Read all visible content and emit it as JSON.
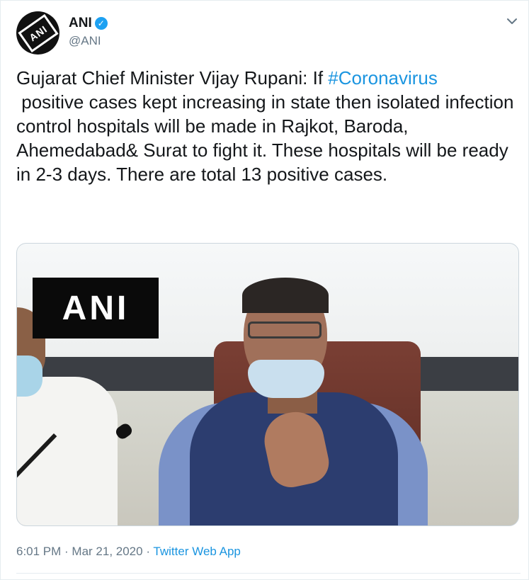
{
  "account": {
    "display_name": "ANI",
    "handle": "@ANI",
    "verified_icon": "verified-badge-icon",
    "avatar_logo_text": "ANI"
  },
  "tweet": {
    "text_before": "Gujarat Chief Minister Vijay Rupani: If ",
    "hashtag": "#Coronavirus",
    "text_after": "\n positive cases kept increasing in state then isolated infection control hospitals will be made in Rajkot, Baroda, Ahemedabad& Surat to fight it. These hospitals will be ready in 2-3 days. There are total 13 positive cases."
  },
  "media": {
    "overlay_logo_text": "ANI"
  },
  "meta": {
    "time": "6:01 PM",
    "separator": " · ",
    "date": "Mar 21, 2020",
    "source": "Twitter Web App"
  },
  "colors": {
    "link": "#1b95e0",
    "verified": "#1da1f2",
    "secondary_text": "#657786"
  },
  "icons": {
    "more": "chevron-down-icon"
  }
}
